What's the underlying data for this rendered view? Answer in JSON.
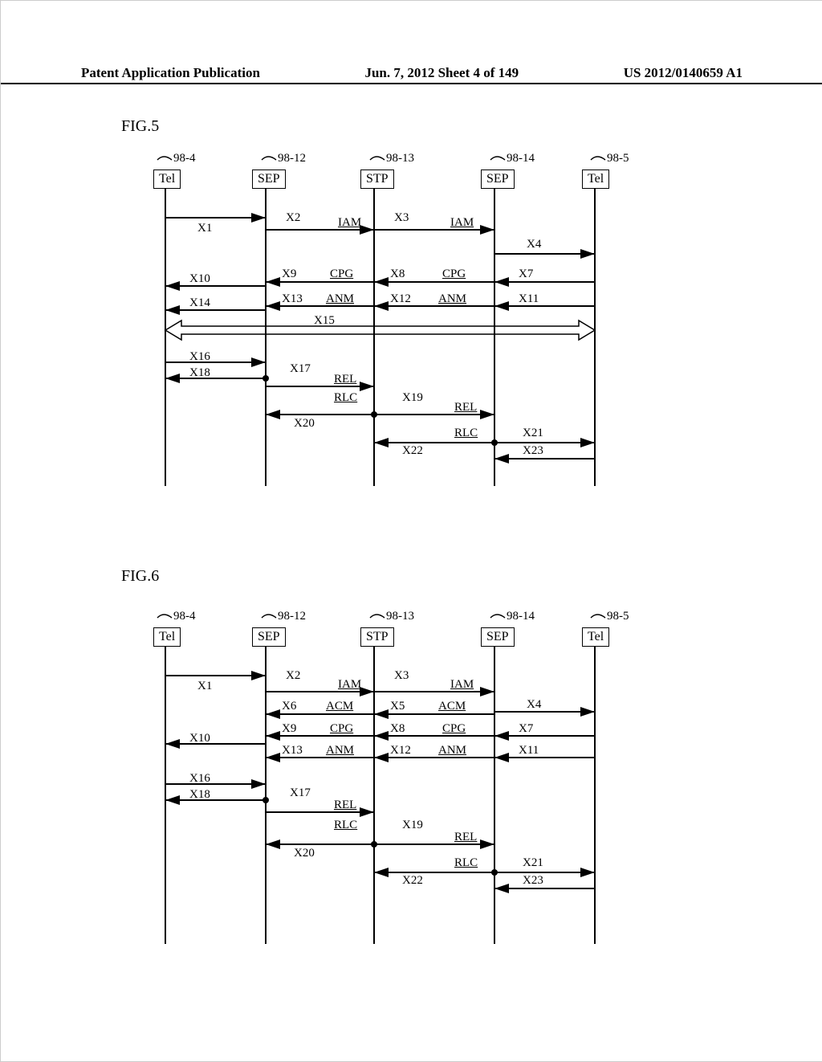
{
  "header": {
    "left": "Patent Application Publication",
    "center": "Jun. 7, 2012  Sheet 4 of 149",
    "right": "US 2012/0140659 A1"
  },
  "figs": {
    "fig5": "FIG.5",
    "fig6": "FIG.6"
  },
  "nodes": {
    "n1": "Tel",
    "n2": "SEP",
    "n3": "STP",
    "n4": "SEP",
    "n5": "Tel",
    "r1": "98-4",
    "r2": "98-12",
    "r3": "98-13",
    "r4": "98-14",
    "r5": "98-5"
  },
  "msgs": {
    "iam": "IAM",
    "cpg": "CPG",
    "anm": "ANM",
    "rel": "REL",
    "rlc": "RLC",
    "acm": "ACM"
  },
  "x": {
    "x1": "X1",
    "x2": "X2",
    "x3": "X3",
    "x4": "X4",
    "x5": "X5",
    "x6": "X6",
    "x7": "X7",
    "x8": "X8",
    "x9": "X9",
    "x10": "X10",
    "x11": "X11",
    "x12": "X12",
    "x13": "X13",
    "x14": "X14",
    "x15": "X15",
    "x16": "X16",
    "x17": "X17",
    "x18": "X18",
    "x19": "X19",
    "x20": "X20",
    "x21": "X21",
    "x22": "X22",
    "x23": "X23"
  }
}
